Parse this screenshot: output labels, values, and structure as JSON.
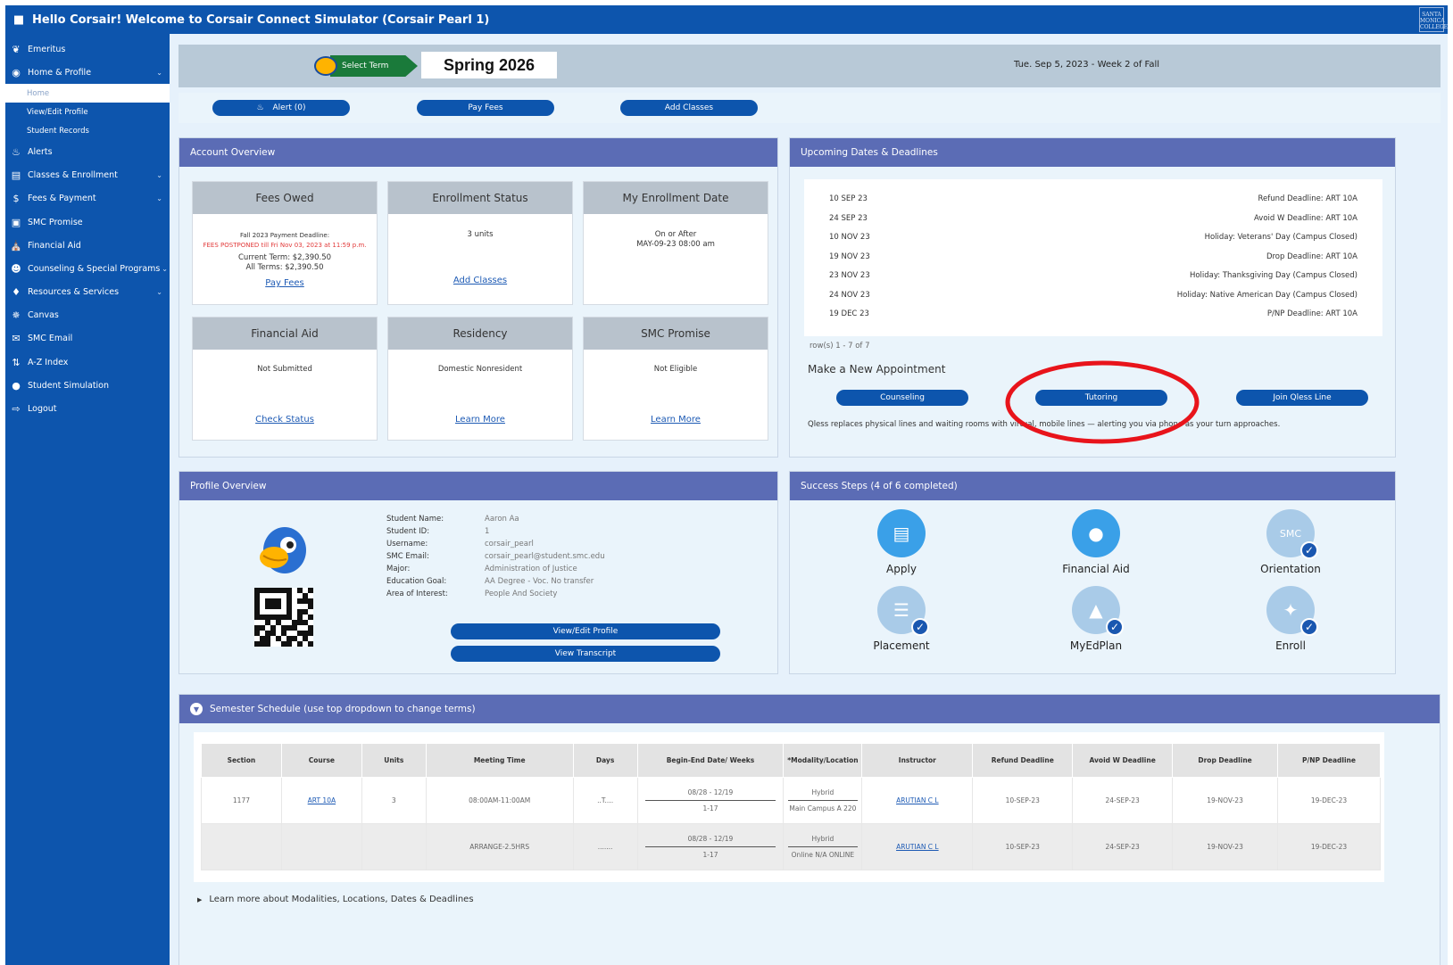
{
  "header": {
    "title": "Hello Corsair! Welcome to Corsair Connect Simulator (Corsair Pearl 1)",
    "logo_text": "SANTA MONICA COLLEGE"
  },
  "sidebar": {
    "items": [
      {
        "label": "Emeritus",
        "icon": "emeritus-icon"
      },
      {
        "label": "Home & Profile",
        "icon": "home-icon"
      },
      {
        "label": "Alerts",
        "icon": "bell-icon"
      },
      {
        "label": "Classes & Enrollment",
        "icon": "list-icon"
      },
      {
        "label": "Fees & Payment",
        "icon": "dollar-icon"
      },
      {
        "label": "SMC Promise",
        "icon": "gift-icon"
      },
      {
        "label": "Financial Aid",
        "icon": "bank-icon"
      },
      {
        "label": "Counseling & Special Programs",
        "icon": "people-icon"
      },
      {
        "label": "Resources & Services",
        "icon": "handshake-icon"
      },
      {
        "label": "Canvas",
        "icon": "canvas-icon"
      },
      {
        "label": "SMC Email",
        "icon": "mail-icon"
      },
      {
        "label": "A-Z Index",
        "icon": "sort-icon"
      },
      {
        "label": "Student Simulation",
        "icon": "user-icon"
      },
      {
        "label": "Logout",
        "icon": "logout-icon"
      }
    ],
    "subitems": [
      "Home",
      "View/Edit Profile",
      "Student Records"
    ]
  },
  "termbar": {
    "select_label": "Select Term",
    "term": "Spring 2026",
    "date": "Tue. Sep 5, 2023 - Week 2 of Fall"
  },
  "actions": {
    "alert": "Alert (0)",
    "pay_fees": "Pay Fees",
    "add_classes": "Add Classes"
  },
  "account": {
    "title": "Account Overview",
    "fees": {
      "title": "Fees Owed",
      "deadline": "Fall 2023 Payment Deadline:",
      "postponed": "FEES POSTPONED till Fri Nov 03, 2023 at 11:59 p.m.",
      "current": "Current Term: $2,390.50",
      "all": "All Terms: $2,390.50",
      "link": "Pay Fees"
    },
    "enrollment": {
      "title": "Enrollment Status",
      "units": "3 units",
      "link": "Add Classes"
    },
    "enroll_date": {
      "title": "My Enrollment Date",
      "line1": "On or After",
      "line2": "MAY-09-23 08:00 am"
    },
    "finaid": {
      "title": "Financial Aid",
      "status": "Not Submitted",
      "link": "Check Status"
    },
    "residency": {
      "title": "Residency",
      "status": "Domestic Nonresident",
      "link": "Learn More"
    },
    "promise": {
      "title": "SMC Promise",
      "status": "Not Eligible",
      "link": "Learn More"
    }
  },
  "deadlines": {
    "title": "Upcoming Dates & Deadlines",
    "rows": [
      {
        "date": "10 SEP 23",
        "desc": "Refund Deadline: ART 10A"
      },
      {
        "date": "24 SEP 23",
        "desc": "Avoid W Deadline: ART 10A"
      },
      {
        "date": "10 NOV 23",
        "desc": "Holiday: Veterans' Day (Campus Closed)"
      },
      {
        "date": "19 NOV 23",
        "desc": "Drop Deadline: ART 10A"
      },
      {
        "date": "23 NOV 23",
        "desc": "Holiday: Thanksgiving Day (Campus Closed)"
      },
      {
        "date": "24 NOV 23",
        "desc": "Holiday: Native American Day (Campus Closed)"
      },
      {
        "date": "19 DEC 23",
        "desc": "P/NP Deadline: ART 10A"
      }
    ],
    "rowcount": "row(s) 1 - 7 of 7",
    "appointment_title": "Make a New Appointment",
    "counseling": "Counseling",
    "tutoring": "Tutoring",
    "qless": "Join Qless Line",
    "qless_note": "Qless replaces physical lines and waiting rooms with virtual, mobile lines — alerting you via phone as your turn approaches.",
    "highlight_color": "#e8141b"
  },
  "profile": {
    "title": "Profile Overview",
    "fields": [
      {
        "label": "Student Name:",
        "value": "Aaron Aa"
      },
      {
        "label": "Student ID:",
        "value": "1"
      },
      {
        "label": "Username:",
        "value": "corsair_pearl"
      },
      {
        "label": "SMC Email:",
        "value": "corsair_pearl@student.smc.edu"
      },
      {
        "label": "Major:",
        "value": "Administration of Justice"
      },
      {
        "label": "Education Goal:",
        "value": "AA Degree - Voc. No transfer"
      },
      {
        "label": "Area of Interest:",
        "value": "People And Society"
      }
    ],
    "view_edit": "View/Edit Profile",
    "transcript": "View Transcript"
  },
  "steps": {
    "title": "Success Steps (4 of 6 completed)",
    "items": [
      {
        "label": "Apply",
        "icon": "apply-icon",
        "done": false
      },
      {
        "label": "Financial Aid",
        "icon": "piggy-bank-icon",
        "done": false
      },
      {
        "label": "Orientation",
        "icon": "smc-sign-icon",
        "done": true
      },
      {
        "label": "Placement",
        "icon": "clipboard-icon",
        "done": true
      },
      {
        "label": "MyEdPlan",
        "icon": "graduation-cap-icon",
        "done": true
      },
      {
        "label": "Enroll",
        "icon": "mouse-icon",
        "done": true
      }
    ]
  },
  "schedule": {
    "title": "Semester Schedule (use top dropdown to change terms)",
    "headers": [
      "Section",
      "Course",
      "Units",
      "Meeting Time",
      "Days",
      "Begin-End Date/ Weeks",
      "*Modality/Location",
      "Instructor",
      "Refund Deadline",
      "Avoid W Deadline",
      "Drop Deadline",
      "P/NP Deadline"
    ],
    "rows": [
      {
        "section": "1177",
        "course": "ART 10A",
        "units": "3",
        "time": "08:00AM-11:00AM",
        "days": "..T....",
        "dates": "08/28 - 12/19",
        "weeks": "1-17",
        "modality": "Hybrid",
        "location": "Main Campus A 220",
        "instructor": "ARUTIAN C L",
        "refund": "10-SEP-23",
        "avoidw": "24-SEP-23",
        "drop": "19-NOV-23",
        "pnp": "19-DEC-23"
      },
      {
        "section": "",
        "course": "",
        "units": "",
        "time": "ARRANGE-2.5HRS",
        "days": ".......",
        "dates": "08/28 - 12/19",
        "weeks": "1-17",
        "modality": "Hybrid",
        "location": "Online N/A ONLINE",
        "instructor": "ARUTIAN C L",
        "refund": "10-SEP-23",
        "avoidw": "24-SEP-23",
        "drop": "19-NOV-23",
        "pnp": "19-DEC-23"
      }
    ],
    "learn_more": "Learn more about Modalities, Locations, Dates & Deadlines"
  }
}
